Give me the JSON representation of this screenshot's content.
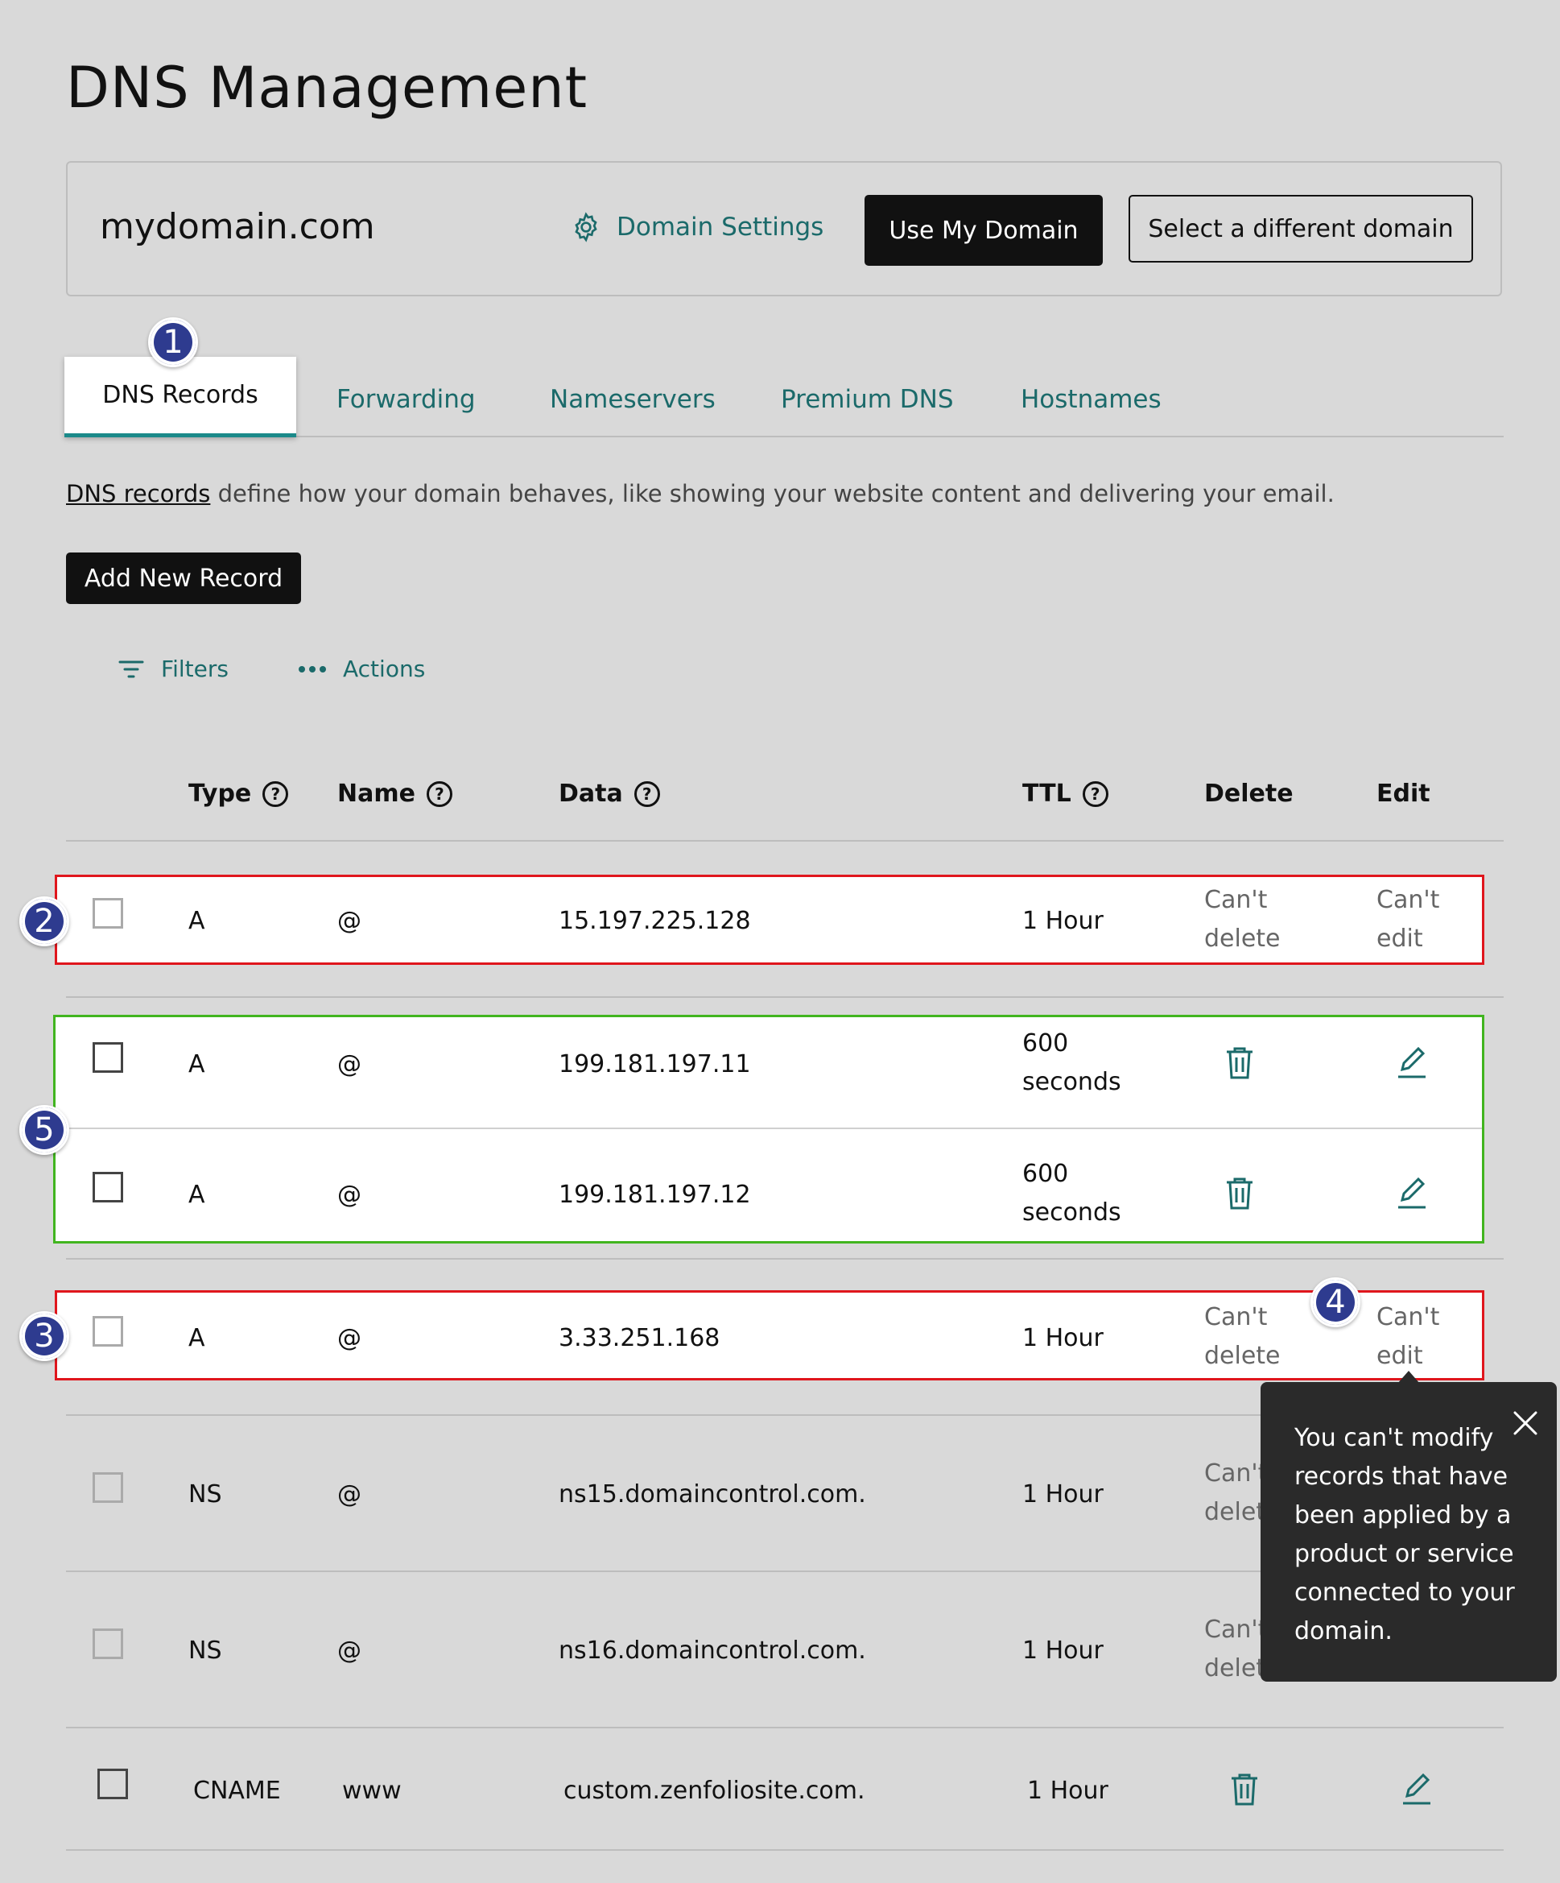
{
  "page_title": "DNS Management",
  "domain_bar": {
    "domain": "mydomain.com",
    "settings_label": "Domain Settings",
    "use_label": "Use My Domain",
    "select_label": "Select a different domain"
  },
  "tabs": [
    "DNS Records",
    "Forwarding",
    "Nameservers",
    "Premium DNS",
    "Hostnames"
  ],
  "description": {
    "link": "DNS records",
    "text": " define how your domain behaves, like showing your website content and delivering your email."
  },
  "add_button": "Add New Record",
  "toolbar": {
    "filters": "Filters",
    "actions": "Actions"
  },
  "columns": {
    "type": "Type",
    "name": "Name",
    "data": "Data",
    "ttl": "TTL",
    "delete": "Delete",
    "edit": "Edit"
  },
  "rows": [
    {
      "type": "A",
      "name": "@",
      "data": "15.197.225.128",
      "ttl": "1 Hour",
      "delete_1": "Can't",
      "delete_2": "delete",
      "edit_1": "Can't",
      "edit_2": "edit"
    },
    {
      "type": "A",
      "name": "@",
      "data": "199.181.197.11",
      "ttl_1": "600",
      "ttl_2": "seconds"
    },
    {
      "type": "A",
      "name": "@",
      "data": "199.181.197.12",
      "ttl_1": "600",
      "ttl_2": "seconds"
    },
    {
      "type": "A",
      "name": "@",
      "data": "3.33.251.168",
      "ttl": "1 Hour",
      "delete_1": "Can't",
      "delete_2": "delete",
      "edit_1": "Can't",
      "edit_2": "edit"
    },
    {
      "type": "NS",
      "name": "@",
      "data": "ns15.domaincontrol.com.",
      "ttl": "1 Hour",
      "delete_1": "Can't",
      "delete_2": "delete"
    },
    {
      "type": "NS",
      "name": "@",
      "data": "ns16.domaincontrol.com.",
      "ttl": "1 Hour",
      "delete_1": "Can't",
      "delete_2": "delete"
    },
    {
      "type": "CNAME",
      "name": "www",
      "data": "custom.zenfoliosite.com.",
      "ttl": "1 Hour"
    }
  ],
  "tooltip": {
    "line1": "You can't modify",
    "line2": "records that have",
    "line3": "been applied by a",
    "line4": "product or service",
    "line5": "connected to your",
    "line6": "domain."
  },
  "badges": [
    "1",
    "2",
    "3",
    "4",
    "5"
  ],
  "colors": {
    "accent": "#1b6a6a",
    "red_outline": "#e0161d",
    "green_outline": "#41b51f",
    "badge": "#2e3b8f"
  }
}
